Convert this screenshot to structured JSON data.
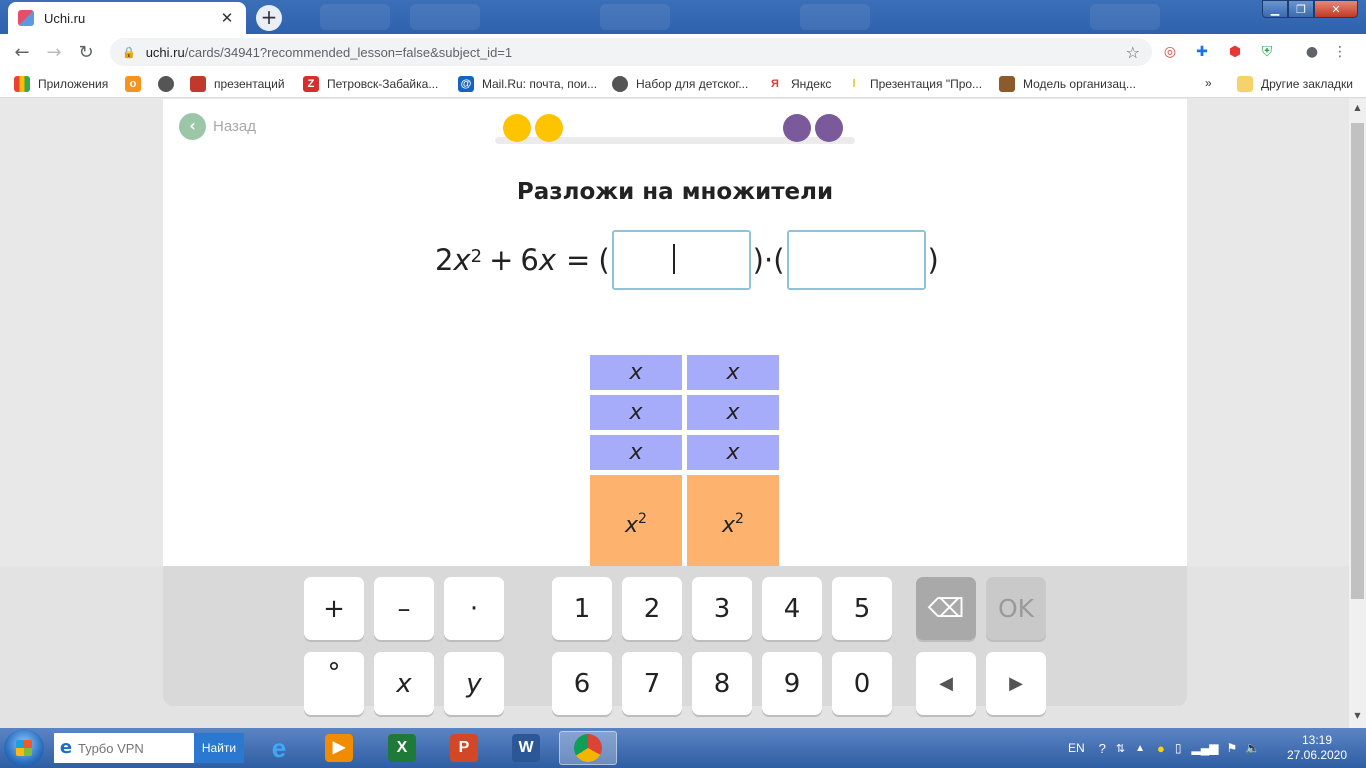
{
  "browser": {
    "tab_title": "Uchi.ru",
    "tab_close": "✕",
    "new_tab": "+",
    "url_host": "uchi.ru",
    "url_rest": "/cards/34941?recommended_lesson=false&subject_id=1"
  },
  "bookmarks": {
    "apps": "Приложения",
    "items": [
      {
        "label": "презентаций"
      },
      {
        "label": "Петровск-Забайка..."
      },
      {
        "label": "Mail.Ru: почта, пои..."
      },
      {
        "label": "Набор для детског..."
      },
      {
        "label": "Яндекс"
      },
      {
        "label": "Презентация \"Про..."
      },
      {
        "label": "Модель организац..."
      }
    ],
    "more": "»",
    "other": "Другие закладки"
  },
  "lesson": {
    "back_label": "Назад",
    "task_title": "Разложи на множители",
    "progress": {
      "done": 2,
      "total": 4
    },
    "equation": {
      "coef1": "2",
      "var": "x",
      "power": "2",
      "plus": "+",
      "coef2": "6",
      "equals": "=",
      "open": "(",
      "close": ")",
      "dot": "·",
      "answer1": "",
      "answer2": ""
    },
    "tiles": {
      "x_label": "x",
      "x2_var": "x",
      "x2_pow": "2"
    }
  },
  "keypad": {
    "plus": "+",
    "minus": "–",
    "dot": "·",
    "degree": "°",
    "x": "x",
    "y": "y",
    "digits_row1": [
      "1",
      "2",
      "3",
      "4",
      "5"
    ],
    "digits_row2": [
      "6",
      "7",
      "8",
      "9",
      "0"
    ],
    "backspace": "⌫",
    "ok": "OK",
    "left": "◀",
    "right": "▶"
  },
  "taskbar": {
    "search_placeholder": "Турбо VPN",
    "search_button": "Найти",
    "lang": "EN",
    "time": "13:19",
    "date": "27.06.2020"
  },
  "colors": {
    "progress_done": "#ffc400",
    "progress_todo": "#7a5a9a",
    "tile_x": "#a7acfa",
    "tile_x2": "#fdb26e",
    "input_border": "#8fc3dc"
  }
}
